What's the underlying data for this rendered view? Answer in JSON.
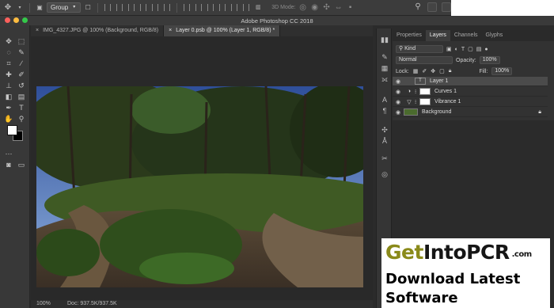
{
  "app": {
    "window_title": "Adobe Photoshop CC 2018"
  },
  "options_bar": {
    "group_select": "Group",
    "mode_3d": "3D Mode:"
  },
  "document_tabs": [
    {
      "label": "IMG_4327.JPG @ 100% (Background, RGB/8)",
      "close": "×",
      "active": false
    },
    {
      "label": "Layer 0.psb @ 100% (Layer 1, RGB/8) *",
      "close": "×",
      "active": true
    }
  ],
  "status": {
    "zoom": "100%",
    "doc": "Doc: 937.5K/937.5K"
  },
  "panel_tabs": [
    "Properties",
    "Layers",
    "Channels",
    "Glyphs"
  ],
  "layers_panel": {
    "filter_kind": "Kind",
    "blend_mode": "Normal",
    "opacity_label": "Opacity:",
    "opacity_value": "100%",
    "lock_label": "Lock:",
    "fill_label": "Fill:",
    "fill_value": "100%",
    "layers": [
      {
        "name": "Layer 1",
        "type": "text",
        "selected": true
      },
      {
        "name": "Curves 1",
        "type": "adjustment",
        "selected": false
      },
      {
        "name": "Vibrance 1",
        "type": "adjustment",
        "selected": false
      },
      {
        "name": "Background",
        "type": "image",
        "selected": false
      }
    ]
  },
  "watermark": {
    "brand_get": "Get",
    "brand_into": "IntoPCR",
    "brand_com": ".com",
    "slogan_line1": "Download Latest",
    "slogan_line2": "Software"
  },
  "colors": {
    "accent_olive": "#8a8a1a",
    "panel_bg": "#323232",
    "canvas_bg": "#292929"
  },
  "icons": [
    "move-icon",
    "marquee-icon",
    "lasso-icon",
    "quick-select-icon",
    "crop-icon",
    "eyedropper-icon",
    "brush-icon",
    "stamp-icon",
    "eraser-icon",
    "gradient-icon",
    "pen-icon",
    "type-icon",
    "path-select-icon",
    "shape-icon",
    "hand-icon",
    "zoom-icon"
  ]
}
